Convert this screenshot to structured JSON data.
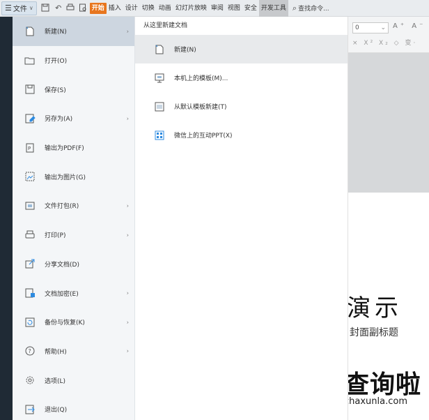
{
  "topbar": {
    "file_menu_label": "文件",
    "tabs": [
      "开始",
      "插入",
      "设计",
      "切换",
      "动画",
      "幻灯片放映",
      "审阅",
      "视图",
      "安全",
      "开发工具"
    ],
    "search_placeholder": "查找命令..."
  },
  "ribbon": {
    "font_size_value": "0",
    "row1_glyphs": "A⁺ A⁻",
    "row2_glyphs": "× X² X₂ ◇ 变·"
  },
  "file_menu": {
    "items": [
      {
        "label": "新建(N)",
        "icon": "new-file-icon",
        "has_submenu": true
      },
      {
        "label": "打开(O)",
        "icon": "folder-open-icon",
        "has_submenu": false
      },
      {
        "label": "保存(S)",
        "icon": "save-icon",
        "has_submenu": false
      },
      {
        "label": "另存为(A)",
        "icon": "save-as-icon",
        "has_submenu": true
      },
      {
        "label": "输出为PDF(F)",
        "icon": "export-pdf-icon",
        "has_submenu": false
      },
      {
        "label": "输出为图片(G)",
        "icon": "export-image-icon",
        "has_submenu": false
      },
      {
        "label": "文件打包(R)",
        "icon": "package-icon",
        "has_submenu": true
      },
      {
        "label": "打印(P)",
        "icon": "print-icon",
        "has_submenu": true
      },
      {
        "label": "分享文档(D)",
        "icon": "share-icon",
        "has_submenu": false
      },
      {
        "label": "文档加密(E)",
        "icon": "encrypt-icon",
        "has_submenu": true
      },
      {
        "label": "备份与恢复(K)",
        "icon": "backup-icon",
        "has_submenu": true
      },
      {
        "label": "帮助(H)",
        "icon": "help-icon",
        "has_submenu": true
      },
      {
        "label": "选项(L)",
        "icon": "gear-icon",
        "has_submenu": false
      },
      {
        "label": "退出(Q)",
        "icon": "exit-icon",
        "has_submenu": false
      }
    ]
  },
  "submenu": {
    "header": "从这里新建文档",
    "items": [
      {
        "label": "新建(N)",
        "icon": "new-file-icon"
      },
      {
        "label": "本机上的模板(M)...",
        "icon": "local-template-icon"
      },
      {
        "label": "从默认模板新建(T)",
        "icon": "default-template-icon"
      },
      {
        "label": "微信上的互动PPT(X)",
        "icon": "wechat-ppt-icon"
      }
    ]
  },
  "slide": {
    "title": "演示",
    "subtitle": "封面副标题"
  },
  "watermark": {
    "text": "查询啦",
    "url": "chaxunla.com"
  },
  "colors": {
    "active_tab": "#e8761e",
    "watermark_blue": "#2e9ef3",
    "selected_item": "#cdd6e0"
  }
}
